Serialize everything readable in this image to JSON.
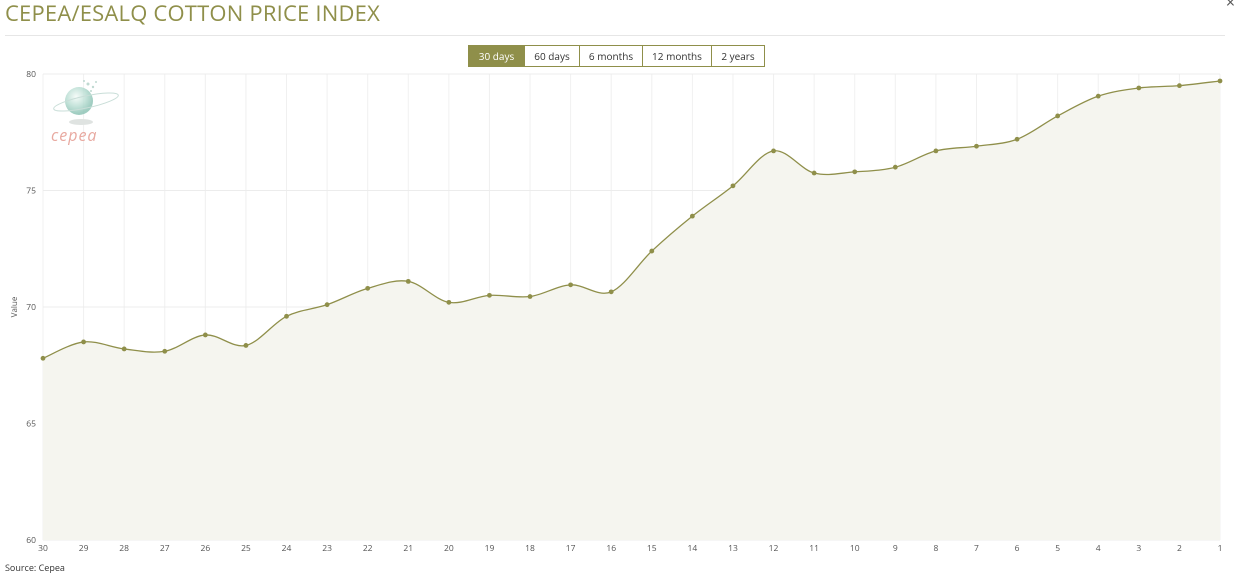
{
  "header": {
    "title": "CEPEA/ESALQ COTTON PRICE INDEX",
    "close_symbol": "×"
  },
  "range_buttons": [
    "30 days",
    "60 days",
    "6 months",
    "12 months",
    "2 years"
  ],
  "active_range": "30 days",
  "logo_text": "cepea",
  "source": "Source: Cepea",
  "colors": {
    "accent": "#8f8f4a",
    "line": "#8f8f4a",
    "fill": "#f5f5ef",
    "logo_text": "#e8a9a0"
  },
  "chart_data": {
    "type": "area",
    "title": "",
    "ylabel": "Value",
    "xlabel": "",
    "ylim": [
      60,
      80
    ],
    "yticks": [
      60,
      65,
      70,
      75,
      80
    ],
    "grid": true,
    "categories": [
      "30",
      "29",
      "28",
      "27",
      "26",
      "25",
      "24",
      "23",
      "22",
      "21",
      "20",
      "19",
      "18",
      "17",
      "16",
      "15",
      "14",
      "13",
      "12",
      "11",
      "10",
      "9",
      "8",
      "7",
      "6",
      "5",
      "4",
      "3",
      "2",
      "1"
    ],
    "series": [
      {
        "values": [
          67.8,
          68.5,
          68.2,
          68.1,
          68.8,
          68.35,
          69.6,
          70.1,
          70.8,
          71.1,
          70.2,
          70.5,
          70.45,
          70.95,
          70.65,
          72.4,
          73.9,
          75.2,
          76.7,
          75.75,
          75.8,
          76.0,
          76.7,
          76.9,
          77.2,
          78.2,
          79.05,
          79.4,
          79.5,
          79.7
        ]
      }
    ]
  }
}
